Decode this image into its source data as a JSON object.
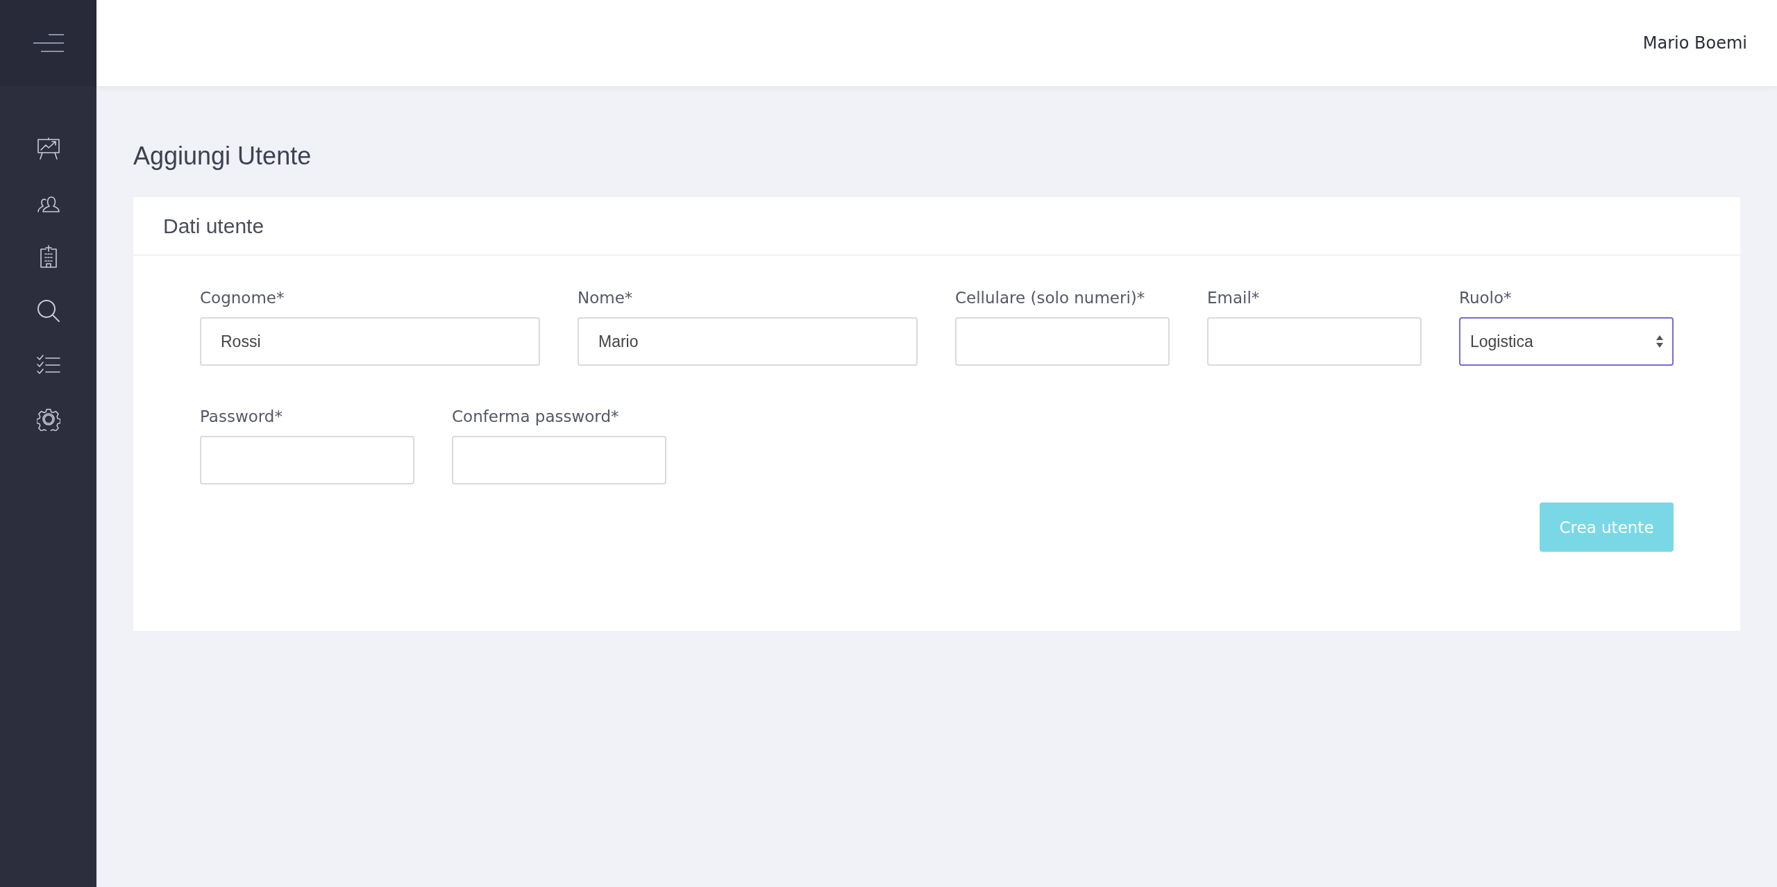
{
  "header": {
    "user_name": "Mario Boemi"
  },
  "sidebar": {
    "items": [
      {
        "kind": "presentation"
      },
      {
        "kind": "users"
      },
      {
        "kind": "building"
      },
      {
        "kind": "search"
      },
      {
        "kind": "checklist"
      },
      {
        "kind": "settings"
      }
    ]
  },
  "page_title": "Aggiungi Utente",
  "card": {
    "title": "Dati utente",
    "rows": [
      [
        {
          "kind": "text",
          "label": "Cognome*",
          "value": "Rossi",
          "focused": false
        },
        {
          "kind": "text",
          "label": "Nome*",
          "value": "Mario",
          "focused": false
        },
        {
          "kind": "text",
          "label": "Cellulare (solo numeri)*",
          "focused": false
        },
        {
          "kind": "text",
          "label": "Email*",
          "focused": false
        },
        {
          "kind": "select",
          "label": "Ruolo*",
          "value": "Logistica",
          "focused": true
        }
      ],
      [
        {
          "kind": "password",
          "label": "Password*",
          "focused": false
        },
        {
          "kind": "password",
          "label": "Conferma password*",
          "focused": false
        }
      ]
    ],
    "submit": {
      "label": "Crea utente",
      "disabled": true
    }
  }
}
